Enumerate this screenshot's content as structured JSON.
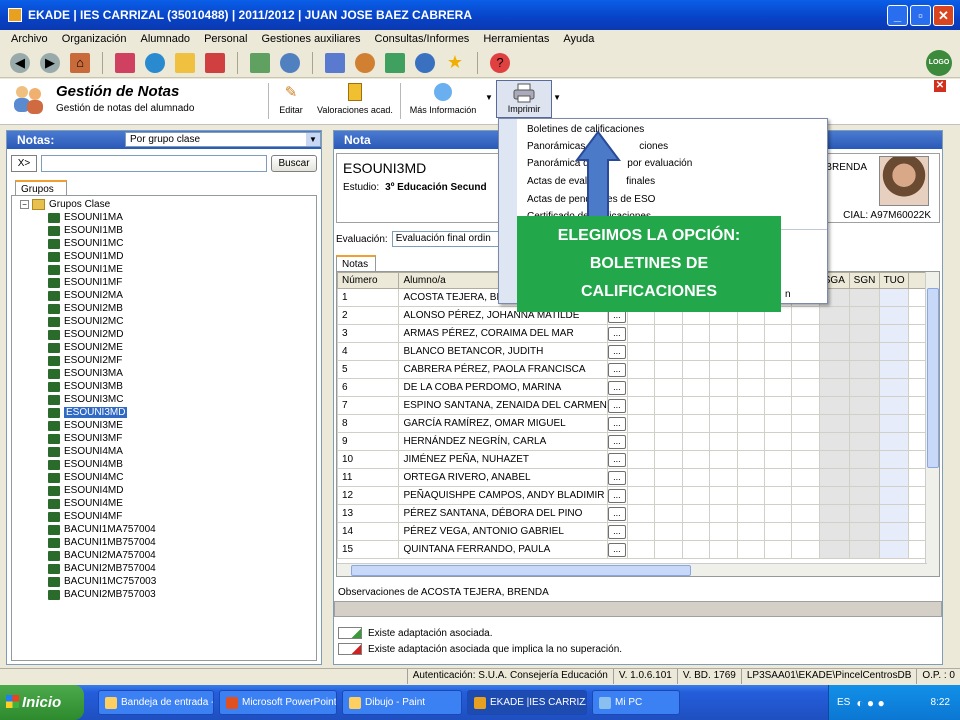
{
  "window": {
    "title": "EKADE | IES CARRIZAL  (35010488) | 2011/2012 | JUAN JOSE BAEZ CABRERA"
  },
  "menu": [
    "Archivo",
    "Organización",
    "Alumnado",
    "Personal",
    "Gestiones auxiliares",
    "Consultas/Informes",
    "Herramientas",
    "Ayuda"
  ],
  "header": {
    "title": "Gestión de Notas",
    "subtitle": "Gestión de notas del alumnado",
    "buttons": {
      "editar": "Editar",
      "valoraciones": "Valoraciones acad.",
      "mas_info": "Más Información",
      "imprimir": "Imprimir"
    }
  },
  "left": {
    "title": "Notas:",
    "filter": "Por grupo clase",
    "xbtn": "X>",
    "search_value": "",
    "buscar": "Buscar",
    "tab": "Grupos",
    "root": "Grupos Clase",
    "groups": [
      "ESOUNI1MA",
      "ESOUNI1MB",
      "ESOUNI1MC",
      "ESOUNI1MD",
      "ESOUNI1ME",
      "ESOUNI1MF",
      "ESOUNI2MA",
      "ESOUNI2MB",
      "ESOUNI2MC",
      "ESOUNI2MD",
      "ESOUNI2ME",
      "ESOUNI2MF",
      "ESOUNI3MA",
      "ESOUNI3MB",
      "ESOUNI3MC",
      "ESOUNI3MD",
      "ESOUNI3ME",
      "ESOUNI3MF",
      "ESOUNI4MA",
      "ESOUNI4MB",
      "ESOUNI4MC",
      "ESOUNI4MD",
      "ESOUNI4ME",
      "ESOUNI4MF",
      "BACUNI1MA757004",
      "BACUNI1MB757004",
      "BACUNI2MA757004",
      "BACUNI2MB757004",
      "BACUNI1MC757003",
      "BACUNI2MB757003"
    ],
    "selected": "ESOUNI3MD"
  },
  "right": {
    "title": "Nota",
    "group_code": "ESOUNI3MD",
    "estudio_label": "Estudio:",
    "estudio": "3º Educación Secund",
    "student_name_partial": "A, BRENDA",
    "cial": "CIAL:  A97M60022K",
    "eval_label": "Evaluación:",
    "eval_value": "Evaluación final ordin",
    "tab": "Notas",
    "columns": [
      "Número",
      "Alumno/a",
      "SGA",
      "SGN",
      "TUO"
    ],
    "rows": [
      [
        "1",
        "ACOSTA TEJERA, BRENDA"
      ],
      [
        "2",
        "ALONSO PÉREZ, JOHANNA MATILDE"
      ],
      [
        "3",
        "ARMAS PÉREZ, CORAIMA DEL MAR"
      ],
      [
        "4",
        "BLANCO BETANCOR, JUDITH"
      ],
      [
        "5",
        "CABRERA PÉREZ, PAOLA FRANCISCA"
      ],
      [
        "6",
        "DE LA COBA PERDOMO, MARINA"
      ],
      [
        "7",
        "ESPINO SANTANA, ZENAIDA DEL CARMEN"
      ],
      [
        "8",
        "GARCÍA RAMÍREZ, OMAR MIGUEL"
      ],
      [
        "9",
        "HERNÁNDEZ NEGRÍN, CARLA"
      ],
      [
        "10",
        "JIMÉNEZ PEÑA, NUHAZET"
      ],
      [
        "11",
        "ORTEGA RIVERO, ANABEL"
      ],
      [
        "12",
        "PEÑAQUISHPE CAMPOS, ANDY BLADIMIR"
      ],
      [
        "13",
        "PÉREZ SANTANA, DÉBORA DEL PINO"
      ],
      [
        "14",
        "PÉREZ VEGA, ANTONIO GABRIEL"
      ],
      [
        "15",
        "QUINTANA FERRANDO, PAULA"
      ]
    ],
    "obs": "Observaciones de ACOSTA TEJERA, BRENDA",
    "legend1": "Existe adaptación asociada.",
    "legend2": "Existe adaptación asociada que implica la no superación."
  },
  "dropdown": [
    "Boletines de calificaciones",
    "Panorámicas de calificaciones",
    "Panorámica de índices por evaluación",
    "Actas de evaluaciones finales",
    "Actas de pendientes de ESO",
    "Certificado de calificaciones"
  ],
  "dropdown_partial": {
    "item1_visible": "Panorámicas de",
    "item1_tail": "ciones",
    "item2_visible": "Panorámica de i",
    "item2_tail": "por evaluación",
    "item3_visible": "Actas de evalua",
    "item3_tail": "finales",
    "extra_tail": "n"
  },
  "callout": {
    "line1": "ELEGIMOS LA OPCIÓN:",
    "line2": "BOLETINES DE",
    "line3": "CALIFICACIONES"
  },
  "status": [
    "Autenticación: S.U.A. Consejería Educación",
    "V. 1.0.6.101",
    "V. BD. 1769",
    "LP3SAA01\\EKADE\\PincelCentrosDB",
    "O.P. : 0"
  ],
  "taskbar": {
    "start": "Inicio",
    "tasks": [
      "Bandeja de entrada -...",
      "Microsoft PowerPoint ...",
      "Dibujo - Paint",
      "EKADE |IES CARRIZA...",
      "Mi PC"
    ],
    "lang": "ES",
    "time": "8:22"
  },
  "colors": {
    "callout": "#22a84a",
    "arrow": "#4a7ac8",
    "titlebar": "#0842c6"
  }
}
